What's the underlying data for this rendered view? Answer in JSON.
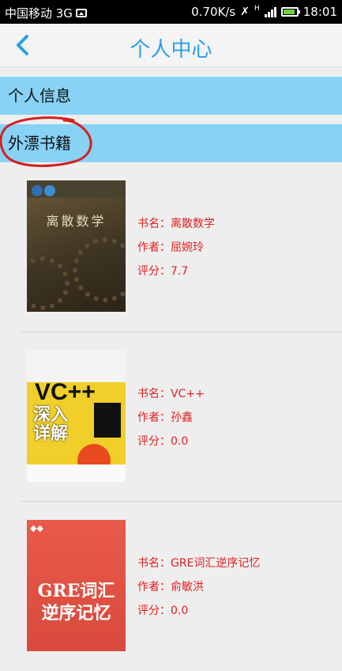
{
  "status_bar": {
    "carrier": "中国移动 3G",
    "speed": "0.70K/s",
    "network_type": "H",
    "time": "18:01"
  },
  "header": {
    "title": "个人中心"
  },
  "sections": [
    {
      "label": "个人信息"
    },
    {
      "label": "外漂书籍"
    }
  ],
  "books": [
    {
      "title_line": "书名：离散数学",
      "author_line": "作者：屈婉玲",
      "rating_line": "评分：7.7",
      "cover_text": "离散数学"
    },
    {
      "title_line": "书名：VC++",
      "author_line": "作者：孙鑫",
      "rating_line": "评分：0.0",
      "cover_text": "VC++",
      "cover_sub": "深入详解"
    },
    {
      "title_line": "书名：GRE词汇逆序记忆",
      "author_line": "作者：俞敏洪",
      "rating_line": "评分：0.0",
      "cover_text": "GRE词汇",
      "cover_sub": "逆序记忆"
    }
  ],
  "colors": {
    "accent": "#2b9ee8",
    "section_bg": "#87d2f5",
    "meta_text": "#e12020",
    "annotation": "#d42020"
  },
  "icons": {
    "back": "chevron-left-icon",
    "mute": "mute-icon",
    "signal": "signal-icon",
    "battery": "battery-icon",
    "image": "image-icon"
  }
}
